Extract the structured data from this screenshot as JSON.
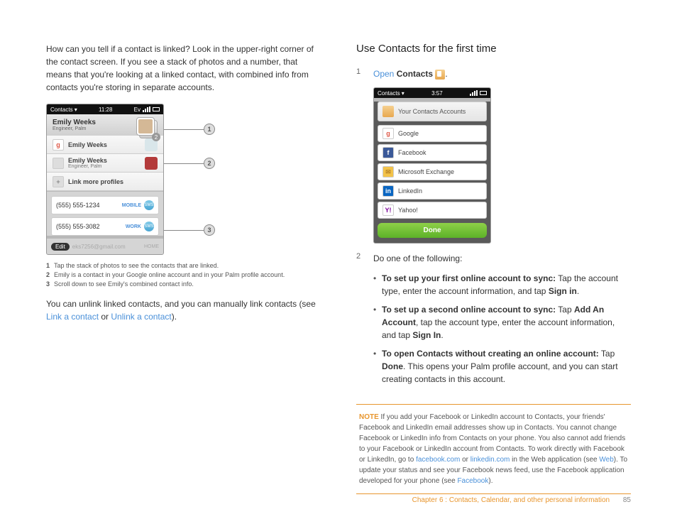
{
  "left": {
    "intro": "How can you tell if a contact is linked? Look in the upper-right corner of the contact screen. If you see a stack of photos and a number, that means that you're looking at a linked contact, with combined info from contacts you're storing in separate accounts.",
    "phone": {
      "status_left": "Contacts",
      "status_time": "11:28",
      "status_sig": "Ev",
      "header_name": "Emily Weeks",
      "header_title": "Engineer, Palm",
      "stack_count": "2",
      "rows": [
        {
          "label": "Emily Weeks",
          "sub": "",
          "icon_text": "g",
          "icon_color": "#fff",
          "icon_fg": "#d54",
          "thumb_color": "#d9e6ea"
        },
        {
          "label": "Emily Weeks",
          "sub": "Engineer, Palm",
          "icon_text": "",
          "icon_color": "#ddd",
          "icon_fg": "#888",
          "thumb_color": "#b33a3a"
        },
        {
          "label": "Link more profiles",
          "sub": "",
          "icon_text": "+",
          "icon_color": "#ddd",
          "icon_fg": "#888",
          "thumb_color": ""
        }
      ],
      "phones": [
        {
          "number": "(555) 555-1234",
          "type": "MOBILE"
        },
        {
          "number": "(555) 555-3082",
          "type": "WORK"
        }
      ],
      "edit": "Edit",
      "email": "eks7256@gmail.com",
      "email_type": "HOME"
    },
    "callouts": [
      "1",
      "2",
      "3"
    ],
    "captions": [
      {
        "n": "1",
        "t": "Tap the stack of photos to see the contacts that are linked."
      },
      {
        "n": "2",
        "t": "Emily is a contact in your Google online account and in your Palm profile account."
      },
      {
        "n": "3",
        "t": "Scroll down to see Emily's combined contact info."
      }
    ],
    "outro_a": "You can unlink linked contacts, and you can manually link contacts (see ",
    "outro_link1": "Link a contact",
    "outro_b": " or ",
    "outro_link2": "Unlink a contact",
    "outro_c": ")."
  },
  "right": {
    "title": "Use Contacts for the first time",
    "step1_a": "Open",
    "step1_b": "Contacts",
    "step1_c": ".",
    "phone": {
      "status_left": "Contacts",
      "status_time": "3:57",
      "header_text": "Your Contacts Accounts",
      "accounts": [
        {
          "label": "Google",
          "bg": "#fff",
          "fg": "#d54",
          "text": "g"
        },
        {
          "label": "Facebook",
          "bg": "#3b5998",
          "fg": "#fff",
          "text": "f"
        },
        {
          "label": "Microsoft Exchange",
          "bg": "#f3c34a",
          "fg": "#b8862b",
          "text": "✉"
        },
        {
          "label": "LinkedIn",
          "bg": "#0a66c2",
          "fg": "#fff",
          "text": "in"
        },
        {
          "label": "Yahoo!",
          "bg": "#fff",
          "fg": "#7b0099",
          "text": "Y!"
        }
      ],
      "done": "Done"
    },
    "step2_intro": "Do one of the following:",
    "bullets": [
      {
        "lead": "To set up your first online account to sync:",
        "rest": " Tap the account type, enter the account information, and tap ",
        "bold2": "Sign in",
        "tail": "."
      },
      {
        "lead": "To set up a second online account to sync:",
        "rest": " Tap ",
        "bold2": "Add An Account",
        "tail": ", tap the account type, enter the account information, and tap ",
        "bold3": "Sign In",
        "tail2": "."
      },
      {
        "lead": "To open Contacts without creating an online account:",
        "rest": " Tap ",
        "bold2": "Done",
        "tail": ". This opens your Palm profile account, and you can start creating contacts in this account."
      }
    ],
    "note_label": "NOTE",
    "note_a": "  If you add your Facebook or LinkedIn account to Contacts, your friends' Facebook and LinkedIn email addresses show up in Contacts. You cannot change Facebook or LinkedIn info from Contacts on your phone. You also cannot add friends to your Facebook or LinkedIn account from Contacts. To work directly with Facebook or LinkedIn, go to ",
    "note_link1": "facebook.com",
    "note_b": " or ",
    "note_link2": "linkedin.com",
    "note_c": " in the Web application (see ",
    "note_link3": "Web",
    "note_d": "). To update your status and see your Facebook news feed, use the Facebook application developed for your phone (see ",
    "note_link4": "Facebook",
    "note_e": ")."
  },
  "footer": {
    "chapter": "Chapter 6 : Contacts, Calendar, and other personal information",
    "page": "85"
  }
}
